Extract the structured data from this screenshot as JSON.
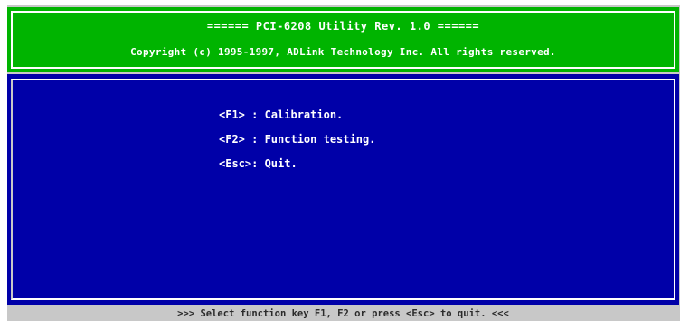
{
  "header": {
    "title": "====== PCI-6208 Utility Rev. 1.0 ======",
    "copyright": "Copyright (c) 1995-1997, ADLink Technology Inc.  All rights reserved."
  },
  "menu": {
    "items": [
      {
        "key": "<F1>",
        "label": "<F1> : Calibration."
      },
      {
        "key": "<F2>",
        "label": "<F2> : Function testing."
      },
      {
        "key": "<Esc>",
        "label": "<Esc>: Quit."
      }
    ]
  },
  "status": {
    "text": ">>> Select function key F1, F2 or press <Esc> to quit. <<<"
  },
  "colors": {
    "header_bg": "#00b400",
    "main_bg": "#0000a8",
    "text": "#ffffff",
    "status_bg": "#c8c8c8"
  }
}
